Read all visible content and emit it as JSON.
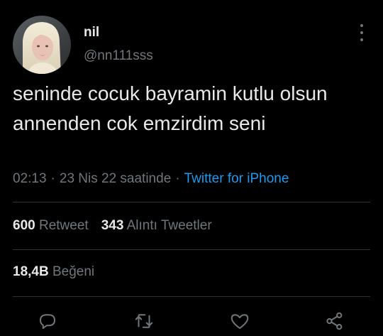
{
  "user": {
    "display_name": "nil",
    "handle": "@nn111sss",
    "avatar_icon": "profile-photo"
  },
  "tweet": {
    "text": "seninde cocuk bayramin kutlu olsun annenden cok emzirdim seni",
    "time": "02:13",
    "date": "23 Nis 22 saatinde",
    "separator": "·",
    "source": "Twitter for iPhone"
  },
  "stats": {
    "retweets_count": "600",
    "retweets_label": "Retweet",
    "quotes_count": "343",
    "quotes_label": "Alıntı Tweetler",
    "likes_count": "18,4B",
    "likes_label": "Beğeni"
  },
  "actions": {
    "reply_icon": "speech-bubble-icon",
    "retweet_icon": "retweet-arrows-icon",
    "like_icon": "heart-icon",
    "share_icon": "share-nodes-icon"
  },
  "colors": {
    "background": "#000000",
    "text": "#e7e9ea",
    "secondary": "#71767b",
    "link": "#1d9bf0",
    "divider": "#2f3336"
  }
}
